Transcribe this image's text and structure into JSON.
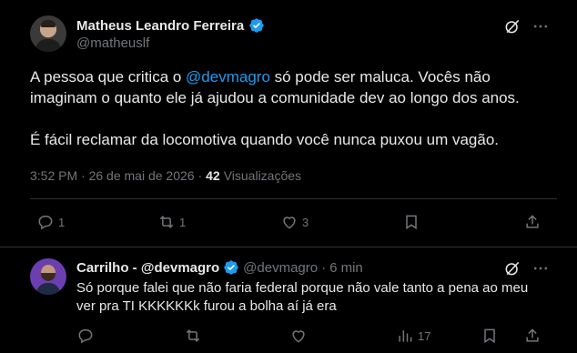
{
  "main_tweet": {
    "author_name": "Matheus Leandro Ferreira",
    "author_handle": "@matheuslf",
    "text_before_mention": "A pessoa que critica o ",
    "mention": "@devmagro",
    "text_after_mention": " só pode ser maluca. Vocês não imaginam o quanto ele já ajudou a comunidade dev ao longo dos anos.",
    "paragraph_2": "É fácil reclamar da locomotiva quando você nunca puxou um vagão.",
    "timestamp": "3:52 PM · 26 de mai de 2026 ·",
    "views_count": "42",
    "views_label": "Visualizações",
    "replies": "1",
    "reposts": "1",
    "likes": "3"
  },
  "reply": {
    "author_name": "Carrilho - @devmagro",
    "author_handle": "@devmagro",
    "separator": "·",
    "time": "6 min",
    "text": "Só porque falei que não faria federal porque não vale tanto a pena ao meu ver pra TI KKKKKKk furou a bolha aí já era",
    "views": "17"
  },
  "colors": {
    "background": "#000000",
    "text": "#e7e9ea",
    "muted": "#71767b",
    "accent": "#1d9bf0",
    "border": "#2f3336"
  },
  "icons": [
    "verified-badge-icon",
    "grok-icon",
    "more-icon",
    "reply-icon",
    "repost-icon",
    "like-icon",
    "bookmark-icon",
    "share-icon",
    "views-icon"
  ]
}
